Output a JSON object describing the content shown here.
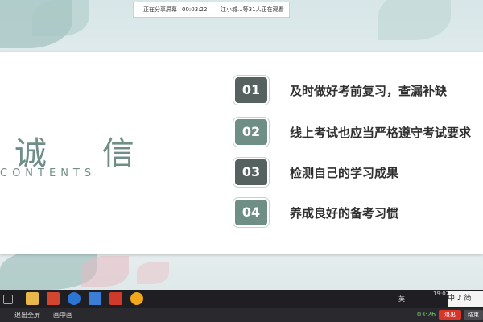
{
  "share_bar": {
    "status": "正在分享屏幕",
    "time": "00:03:22",
    "viewers": "江小城...等31人正在观看"
  },
  "slide": {
    "title": "诚 信",
    "subtitle": "CONTENTS",
    "items": [
      {
        "number": "01",
        "label": "及时做好考前复习，查漏补缺",
        "color": "#56625f"
      },
      {
        "number": "02",
        "label": "线上考试也应当严格遵守考试要求",
        "color": "#6f8f86"
      },
      {
        "number": "03",
        "label": "检测自己的学习成果",
        "color": "#56625f"
      },
      {
        "number": "04",
        "label": "养成良好的备考习惯",
        "color": "#6f8f86"
      }
    ]
  },
  "taskbar": {
    "ime": "中 ♪ 简",
    "lang": "英",
    "clock": "19:02"
  },
  "bottombar": {
    "exit_fullscreen": "退出全屏",
    "picture_in_picture": "画中画",
    "duration": "03:26",
    "exit_button": "退出",
    "end_button": "结束"
  }
}
